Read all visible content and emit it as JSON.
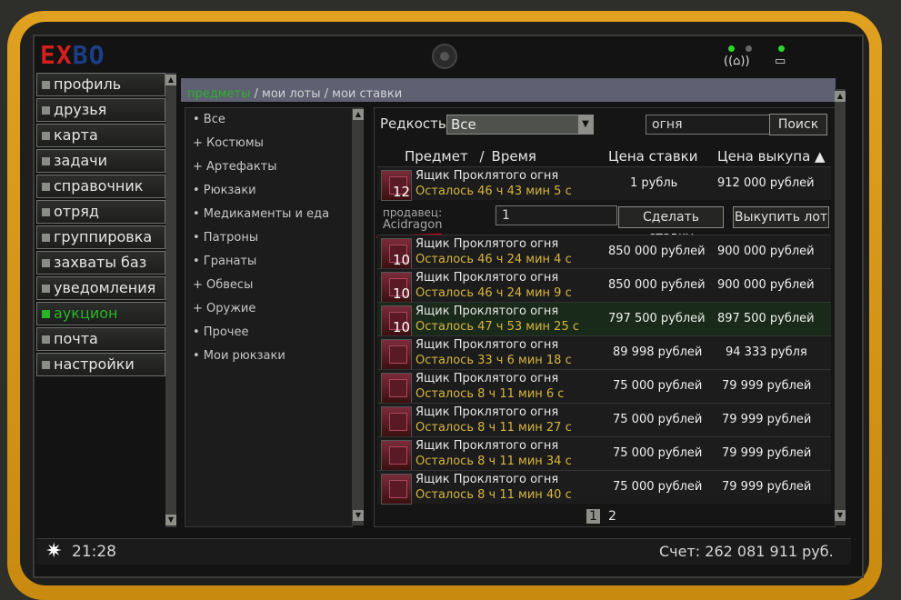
{
  "header": {
    "logo_a": "EX",
    "logo_b": "BO"
  },
  "sidebar": {
    "items": [
      {
        "label": "профиль"
      },
      {
        "label": "друзья"
      },
      {
        "label": "карта"
      },
      {
        "label": "задачи"
      },
      {
        "label": "справочник"
      },
      {
        "label": "отряд"
      },
      {
        "label": "группировка"
      },
      {
        "label": "захваты баз"
      },
      {
        "label": "уведомления"
      },
      {
        "label": "аукцион"
      },
      {
        "label": "почта"
      },
      {
        "label": "настройки"
      }
    ]
  },
  "breadcrumbs": {
    "a": "предметы",
    "b": "мои лоты",
    "c": "мои ставки"
  },
  "categories": [
    {
      "label": "• Все"
    },
    {
      "label": "+ Костюмы"
    },
    {
      "label": "+ Артефакты"
    },
    {
      "label": "• Рюкзаки"
    },
    {
      "label": "• Медикаменты и еда"
    },
    {
      "label": "• Патроны"
    },
    {
      "label": "• Гранаты"
    },
    {
      "label": "+ Обвесы"
    },
    {
      "label": "+ Оружие"
    },
    {
      "label": "• Прочее"
    },
    {
      "label": "• Мои рюкзаки"
    }
  ],
  "filters": {
    "rarity_label": "Редкость",
    "rarity_value": "Все",
    "search_value": "огня",
    "search_button": "Поиск"
  },
  "table": {
    "col_item": "Предмет",
    "col_sep": "/",
    "col_time": "Время",
    "col_bid": "Цена ставки",
    "col_buyout": "Цена выкупа ▲"
  },
  "seller": {
    "label": "продавец:",
    "name": "Acidragon"
  },
  "bid": {
    "value": "1",
    "bid_button": "Сделать ставку",
    "buyout_button": "Выкупить лот"
  },
  "rows": [
    {
      "qty": "12",
      "name": "Ящик Проклятого огня",
      "time": "Осталось 46 ч 43 мин 5 с",
      "bid": "1 рубль",
      "buyout": "912 000 рублей"
    },
    {
      "qty": "10",
      "name": "Ящик Проклятого огня",
      "time": "Осталось 46 ч 24 мин 4 с",
      "bid": "850 000 рублей",
      "buyout": "900 000 рублей"
    },
    {
      "qty": "10",
      "name": "Ящик Проклятого огня",
      "time": "Осталось 46 ч 24 мин 9 с",
      "bid": "850 000 рублей",
      "buyout": "900 000 рублей"
    },
    {
      "qty": "10",
      "name": "Ящик Проклятого огня",
      "time": "Осталось 47 ч 53 мин 25 с",
      "bid": "797 500 рублей",
      "buyout": "897 500 рублей"
    },
    {
      "qty": "",
      "name": "Ящик Проклятого огня",
      "time": "Осталось 33 ч 6 мин 18 с",
      "bid": "89 998 рублей",
      "buyout": "94 333 рубля"
    },
    {
      "qty": "",
      "name": "Ящик Проклятого огня",
      "time": "Осталось 8 ч 11 мин 6 с",
      "bid": "75 000 рублей",
      "buyout": "79 999 рублей"
    },
    {
      "qty": "",
      "name": "Ящик Проклятого огня",
      "time": "Осталось 8 ч 11 мин 27 с",
      "bid": "75 000 рублей",
      "buyout": "79 999 рублей"
    },
    {
      "qty": "",
      "name": "Ящик Проклятого огня",
      "time": "Осталось 8 ч 11 мин 34 с",
      "bid": "75 000 рублей",
      "buyout": "79 999 рублей"
    },
    {
      "qty": "",
      "name": "Ящик Проклятого огня",
      "time": "Осталось 8 ч 11 мин 40 с",
      "bid": "75 000 рублей",
      "buyout": "79 999 рублей"
    }
  ],
  "pager": {
    "p1": "1",
    "p2": "2"
  },
  "footer": {
    "clock": "21:28",
    "balance": "Счет: 262 081 911 руб."
  }
}
